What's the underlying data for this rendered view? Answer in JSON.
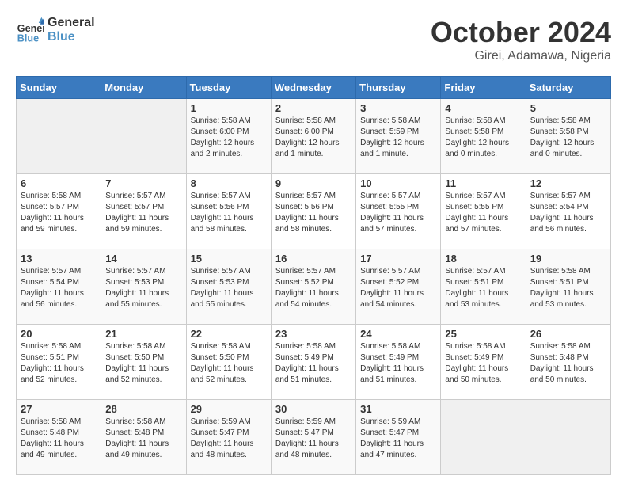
{
  "header": {
    "logo_line1": "General",
    "logo_line2": "Blue",
    "month": "October 2024",
    "location": "Girei, Adamawa, Nigeria"
  },
  "weekdays": [
    "Sunday",
    "Monday",
    "Tuesday",
    "Wednesday",
    "Thursday",
    "Friday",
    "Saturday"
  ],
  "weeks": [
    [
      {
        "day": "",
        "info": ""
      },
      {
        "day": "",
        "info": ""
      },
      {
        "day": "1",
        "info": "Sunrise: 5:58 AM\nSunset: 6:00 PM\nDaylight: 12 hours\nand 2 minutes."
      },
      {
        "day": "2",
        "info": "Sunrise: 5:58 AM\nSunset: 6:00 PM\nDaylight: 12 hours\nand 1 minute."
      },
      {
        "day": "3",
        "info": "Sunrise: 5:58 AM\nSunset: 5:59 PM\nDaylight: 12 hours\nand 1 minute."
      },
      {
        "day": "4",
        "info": "Sunrise: 5:58 AM\nSunset: 5:58 PM\nDaylight: 12 hours\nand 0 minutes."
      },
      {
        "day": "5",
        "info": "Sunrise: 5:58 AM\nSunset: 5:58 PM\nDaylight: 12 hours\nand 0 minutes."
      }
    ],
    [
      {
        "day": "6",
        "info": "Sunrise: 5:58 AM\nSunset: 5:57 PM\nDaylight: 11 hours\nand 59 minutes."
      },
      {
        "day": "7",
        "info": "Sunrise: 5:57 AM\nSunset: 5:57 PM\nDaylight: 11 hours\nand 59 minutes."
      },
      {
        "day": "8",
        "info": "Sunrise: 5:57 AM\nSunset: 5:56 PM\nDaylight: 11 hours\nand 58 minutes."
      },
      {
        "day": "9",
        "info": "Sunrise: 5:57 AM\nSunset: 5:56 PM\nDaylight: 11 hours\nand 58 minutes."
      },
      {
        "day": "10",
        "info": "Sunrise: 5:57 AM\nSunset: 5:55 PM\nDaylight: 11 hours\nand 57 minutes."
      },
      {
        "day": "11",
        "info": "Sunrise: 5:57 AM\nSunset: 5:55 PM\nDaylight: 11 hours\nand 57 minutes."
      },
      {
        "day": "12",
        "info": "Sunrise: 5:57 AM\nSunset: 5:54 PM\nDaylight: 11 hours\nand 56 minutes."
      }
    ],
    [
      {
        "day": "13",
        "info": "Sunrise: 5:57 AM\nSunset: 5:54 PM\nDaylight: 11 hours\nand 56 minutes."
      },
      {
        "day": "14",
        "info": "Sunrise: 5:57 AM\nSunset: 5:53 PM\nDaylight: 11 hours\nand 55 minutes."
      },
      {
        "day": "15",
        "info": "Sunrise: 5:57 AM\nSunset: 5:53 PM\nDaylight: 11 hours\nand 55 minutes."
      },
      {
        "day": "16",
        "info": "Sunrise: 5:57 AM\nSunset: 5:52 PM\nDaylight: 11 hours\nand 54 minutes."
      },
      {
        "day": "17",
        "info": "Sunrise: 5:57 AM\nSunset: 5:52 PM\nDaylight: 11 hours\nand 54 minutes."
      },
      {
        "day": "18",
        "info": "Sunrise: 5:57 AM\nSunset: 5:51 PM\nDaylight: 11 hours\nand 53 minutes."
      },
      {
        "day": "19",
        "info": "Sunrise: 5:58 AM\nSunset: 5:51 PM\nDaylight: 11 hours\nand 53 minutes."
      }
    ],
    [
      {
        "day": "20",
        "info": "Sunrise: 5:58 AM\nSunset: 5:51 PM\nDaylight: 11 hours\nand 52 minutes."
      },
      {
        "day": "21",
        "info": "Sunrise: 5:58 AM\nSunset: 5:50 PM\nDaylight: 11 hours\nand 52 minutes."
      },
      {
        "day": "22",
        "info": "Sunrise: 5:58 AM\nSunset: 5:50 PM\nDaylight: 11 hours\nand 52 minutes."
      },
      {
        "day": "23",
        "info": "Sunrise: 5:58 AM\nSunset: 5:49 PM\nDaylight: 11 hours\nand 51 minutes."
      },
      {
        "day": "24",
        "info": "Sunrise: 5:58 AM\nSunset: 5:49 PM\nDaylight: 11 hours\nand 51 minutes."
      },
      {
        "day": "25",
        "info": "Sunrise: 5:58 AM\nSunset: 5:49 PM\nDaylight: 11 hours\nand 50 minutes."
      },
      {
        "day": "26",
        "info": "Sunrise: 5:58 AM\nSunset: 5:48 PM\nDaylight: 11 hours\nand 50 minutes."
      }
    ],
    [
      {
        "day": "27",
        "info": "Sunrise: 5:58 AM\nSunset: 5:48 PM\nDaylight: 11 hours\nand 49 minutes."
      },
      {
        "day": "28",
        "info": "Sunrise: 5:58 AM\nSunset: 5:48 PM\nDaylight: 11 hours\nand 49 minutes."
      },
      {
        "day": "29",
        "info": "Sunrise: 5:59 AM\nSunset: 5:47 PM\nDaylight: 11 hours\nand 48 minutes."
      },
      {
        "day": "30",
        "info": "Sunrise: 5:59 AM\nSunset: 5:47 PM\nDaylight: 11 hours\nand 48 minutes."
      },
      {
        "day": "31",
        "info": "Sunrise: 5:59 AM\nSunset: 5:47 PM\nDaylight: 11 hours\nand 47 minutes."
      },
      {
        "day": "",
        "info": ""
      },
      {
        "day": "",
        "info": ""
      }
    ]
  ]
}
